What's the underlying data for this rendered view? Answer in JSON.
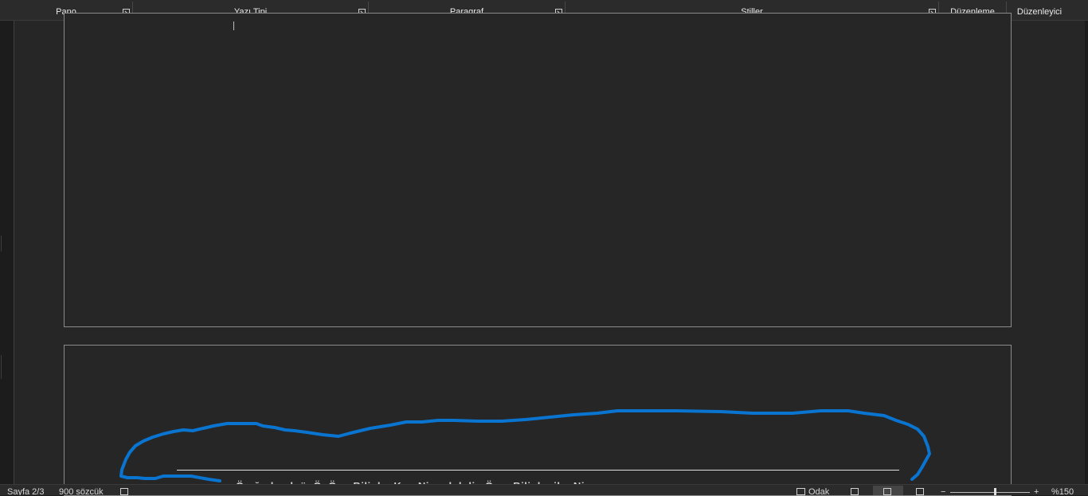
{
  "ribbon": {
    "groups": [
      {
        "label": "Pano"
      },
      {
        "label": "Yazı Tipi"
      },
      {
        "label": "Paragraf"
      },
      {
        "label": "Stiller"
      },
      {
        "label": "Düzenleme"
      },
      {
        "label": "Düzenleyici"
      }
    ]
  },
  "document": {
    "cut_off_line": "Ö...ğ.. l.. ..l..ü..Ö. Ö.... Bili..l... K.... Ni..... l..h.li.. Ö..... Bili..l... il... Ni......",
    "annotation_color": "#0a74d1"
  },
  "status": {
    "page": "Sayfa 2/3",
    "words": "900 sözcük",
    "focus": "Odak",
    "zoom": "%150",
    "zoom_minus": "−",
    "zoom_plus": "+"
  }
}
